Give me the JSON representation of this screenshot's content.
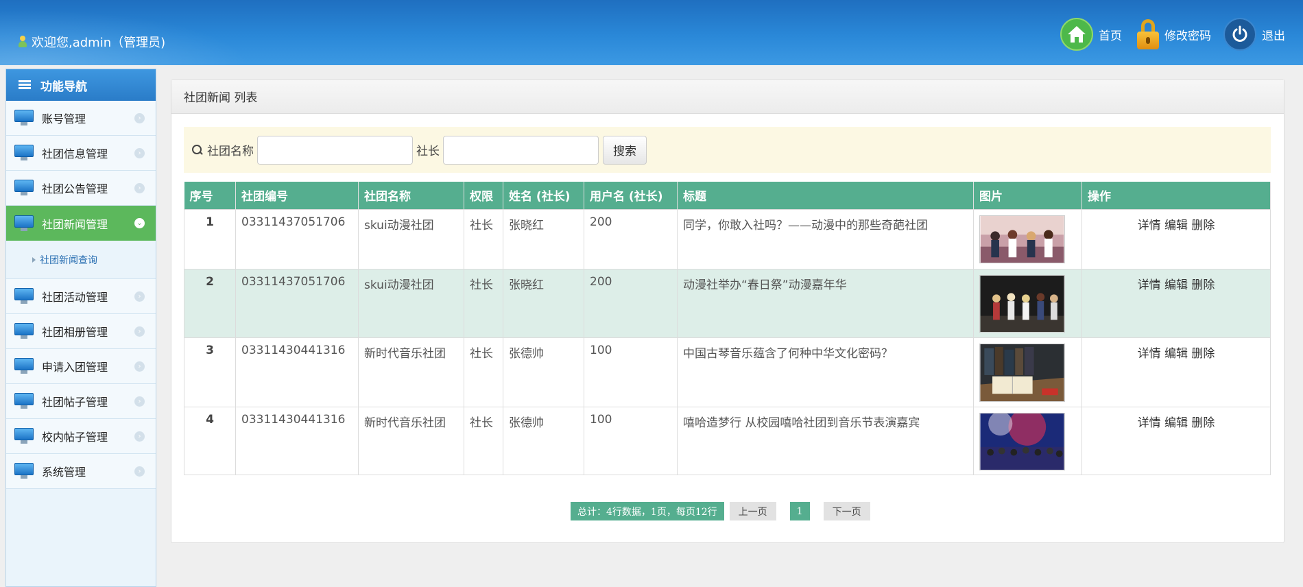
{
  "header": {
    "welcome": "欢迎您,admin（管理员)",
    "links": {
      "home": "首页",
      "change_password": "修改密码",
      "logout": "退出"
    }
  },
  "sidebar": {
    "title": "功能导航",
    "items": [
      {
        "label": "账号管理"
      },
      {
        "label": "社团信息管理"
      },
      {
        "label": "社团公告管理"
      },
      {
        "label": "社团新闻管理",
        "active": true
      },
      {
        "label": "社团活动管理"
      },
      {
        "label": "社团相册管理"
      },
      {
        "label": "申请入团管理"
      },
      {
        "label": "社团帖子管理"
      },
      {
        "label": "校内帖子管理"
      },
      {
        "label": "系统管理"
      }
    ],
    "sub_item": "社团新闻查询"
  },
  "panel": {
    "title": "社团新闻 列表",
    "search": {
      "club_name_label": "社团名称",
      "leader_label": "社长",
      "button": "搜索"
    },
    "columns": [
      "序号",
      "社团编号",
      "社团名称",
      "权限",
      "姓名 (社长)",
      "用户名 (社长)",
      "标题",
      "图片",
      "操作"
    ],
    "rows": [
      {
        "no": "1",
        "club_id": "03311437051706",
        "club_name": "skui动漫社团",
        "role": "社长",
        "name": "张晓红",
        "username": "200",
        "title": "同学，你敢入社吗？——动漫中的那些奇葩社团"
      },
      {
        "no": "2",
        "club_id": "03311437051706",
        "club_name": "skui动漫社团",
        "role": "社长",
        "name": "张晓红",
        "username": "200",
        "title": "动漫社举办“春日祭”动漫嘉年华"
      },
      {
        "no": "3",
        "club_id": "03311430441316",
        "club_name": "新时代音乐社团",
        "role": "社长",
        "name": "张德帅",
        "username": "100",
        "title": "中国古琴音乐蕴含了何种中华文化密码？"
      },
      {
        "no": "4",
        "club_id": "03311430441316",
        "club_name": "新时代音乐社团",
        "role": "社长",
        "name": "张德帅",
        "username": "100",
        "title": "嘻哈造梦行 从校园嘻哈社团到音乐节表演嘉宾"
      }
    ],
    "ops": {
      "detail": "详情",
      "edit": "编辑",
      "delete": "删除"
    },
    "pager": {
      "total": "总计：4行数据，1页，每页12行",
      "prev": "上一页",
      "page": "1",
      "next": "下一页"
    }
  },
  "colors": {
    "header_blue": "#2a88d8",
    "table_head": "#55ae8f",
    "active_nav": "#5cb85c",
    "search_bg": "#fcf8e3"
  }
}
